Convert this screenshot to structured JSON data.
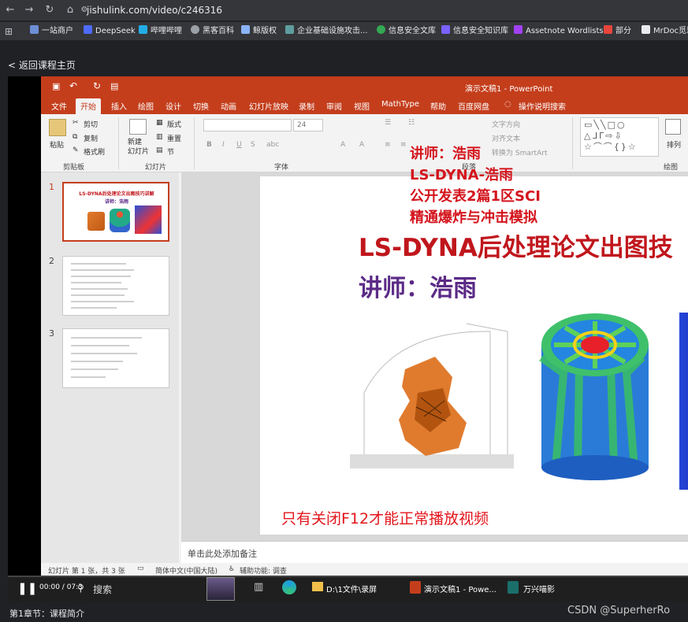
{
  "browser": {
    "url": "jishulink.com/video/c246316",
    "bookmarks": [
      "一站商户",
      "DeepSeek",
      "哔哩哔哩",
      "黑客百科",
      "鲸版权",
      "企业基础设施攻击...",
      "信息安全文库",
      "信息安全知识库",
      "Assetnote Wordlists",
      "部分",
      "MrDoc觅思"
    ]
  },
  "page": {
    "back_link": "< 返回课程主页",
    "chapter": "第1章节：课程简介",
    "watermark": "CSDN @SuperherRo"
  },
  "powerpoint": {
    "title": "演示文稿1 - PowerPoint",
    "tabs": [
      "文件",
      "开始",
      "插入",
      "绘图",
      "设计",
      "切换",
      "动画",
      "幻灯片放映",
      "录制",
      "审阅",
      "视图",
      "MathType",
      "帮助",
      "百度网盘",
      "操作说明搜索"
    ],
    "ribbon": {
      "paste": "粘贴",
      "cut": "剪切",
      "copy": "复制",
      "format_painter": "格式刷",
      "clipboard_group": "剪贴板",
      "new_slide": "新建\n幻灯片",
      "layout": "版式",
      "reset": "重置",
      "section": "节",
      "slides_group": "幻灯片",
      "font_size": "24",
      "font_group": "字体",
      "text_direction": "文字方向",
      "align_text": "对齐文本",
      "smartart": "转换为 SmartArt",
      "paragraph_group": "段落",
      "arrange": "排列",
      "drawing_group": "绘图"
    },
    "overlay_text": [
      "讲师：浩雨",
      "LS-DYNA-浩雨",
      "公开发表2篇1区SCI",
      "精通爆炸与冲击模拟"
    ],
    "slide": {
      "title": "LS-DYNA后处理论文出图技",
      "subtitle": "讲师：浩雨",
      "footer_note": "只有关闭F12才能正常播放视频"
    },
    "thumbnails": {
      "numbers": [
        "1",
        "2",
        "3"
      ],
      "slide1_title": "LS-DYNA后处理论文出图技巧讲解",
      "slide1_sub": "讲师：浩雨"
    },
    "notes_placeholder": "单击此处添加备注",
    "status": {
      "slide_count": "幻灯片 第 1 张，共 3 张",
      "language": "简体中文(中国大陆)",
      "accessibility": "辅助功能: 调查"
    }
  },
  "taskbar": {
    "search": "搜索",
    "time": "00:00 / 07:3",
    "apps": [
      "D:\\1文件\\录屏",
      "演示文稿1 - Powe...",
      "万兴喵影"
    ]
  },
  "colors": {
    "ppt_accent": "#c43e1c",
    "overlay_red": "#d4141c",
    "title_red": "#c0161c",
    "subtitle_purple": "#5b2a86"
  }
}
